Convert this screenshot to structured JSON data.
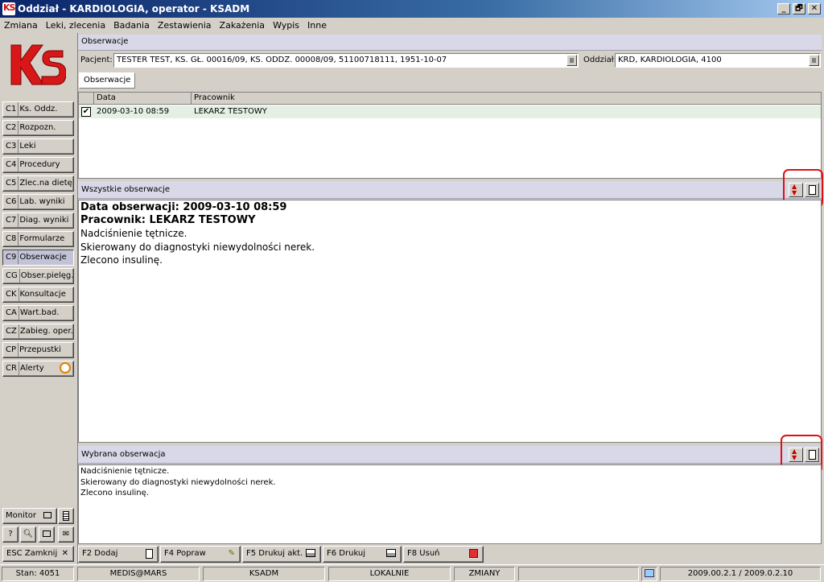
{
  "window": {
    "logo_text": "KS",
    "title": "Oddział - KARDIOLOGIA, operator - KSADM",
    "btn_min": "_",
    "btn_restore": "🗗",
    "btn_close": "✕"
  },
  "menu": {
    "items": [
      "Zmiana",
      "Leki, zlecenia",
      "Badania",
      "Zestawienia",
      "Zakażenia",
      "Wypis",
      "Inne"
    ]
  },
  "sidebar": {
    "logo_text": "KS",
    "items": [
      {
        "code": "C1",
        "label": "Ks. Oddz."
      },
      {
        "code": "C2",
        "label": "Rozpozn."
      },
      {
        "code": "C3",
        "label": "Leki"
      },
      {
        "code": "C4",
        "label": "Procedury"
      },
      {
        "code": "C5",
        "label": "Zlec.na dietę"
      },
      {
        "code": "C6",
        "label": "Lab. wyniki"
      },
      {
        "code": "C7",
        "label": "Diag. wyniki"
      },
      {
        "code": "C8",
        "label": "Formularze"
      },
      {
        "code": "C9",
        "label": "Obserwacje",
        "active": true
      },
      {
        "code": "CG",
        "label": "Obser.pielęg."
      },
      {
        "code": "CK",
        "label": "Konsultacje"
      },
      {
        "code": "CA",
        "label": "Wart.bad."
      },
      {
        "code": "CZ",
        "label": "Zabieg. oper."
      },
      {
        "code": "CP",
        "label": "Przepustki"
      },
      {
        "code": "CR",
        "label": "Alerty"
      }
    ],
    "monitor_label": "Monitor",
    "help_label": "?",
    "close_label": "ESC Zamknij"
  },
  "main": {
    "header": "Obserwacje",
    "patient_label": "Pacjent:",
    "patient_value": "TESTER TEST, KS. GŁ. 00016/09, KS. ODDZ. 00008/09, 51100718111, 1951-10-07",
    "dept_label": "Oddział:",
    "dept_value": "KRD, KARDIOLOGIA, 4100",
    "tab": "Obserwacje",
    "grid": {
      "columns": [
        "Data",
        "Pracownik"
      ],
      "rows": [
        {
          "checked": true,
          "date": "2009-03-10 08:59",
          "worker": "LEKARZ TESTOWY"
        }
      ]
    },
    "all_obs": {
      "header": "Wszystkie obserwacje",
      "date_line": "Data obserwacji: 2009-03-10 08:59",
      "worker_line": "Pracownik: LEKARZ TESTOWY",
      "lines": [
        "Nadciśnienie tętnicze.",
        "Skierowany do diagnostyki niewydolności nerek.",
        "Zlecono insulinę."
      ]
    },
    "selected_obs": {
      "header": "Wybrana obserwacja",
      "lines": [
        "Nadciśnienie tętnicze.",
        "Skierowany do diagnostyki niewydolności nerek.",
        "Zlecono insulinę."
      ]
    }
  },
  "footer": {
    "buttons": [
      {
        "label": "F2 Dodaj",
        "icon": "new-document-icon"
      },
      {
        "label": "F4 Popraw",
        "icon": "edit-pencil-icon"
      },
      {
        "label": "F5 Drukuj akt.",
        "icon": "printer-icon"
      },
      {
        "label": "F6 Drukuj",
        "icon": "printer-icon"
      },
      {
        "label": "F8 Usuń",
        "icon": "delete-icon"
      }
    ]
  },
  "status": {
    "stan": "Stan: 4051",
    "user": "MEDIS@MARS",
    "operator": "KSADM",
    "mode": "LOKALNIE",
    "changes": "ZMIANY",
    "version": "2009.00.2.1 / 2009.0.2.10"
  },
  "colors": {
    "accent_red": "#e01010",
    "title_blue": "#0a246a",
    "panel_header": "#d8d8e8"
  }
}
